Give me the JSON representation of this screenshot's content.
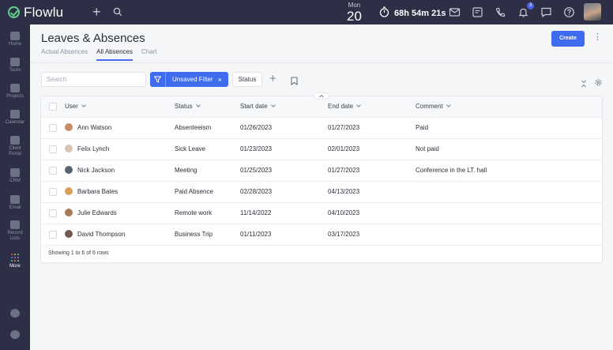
{
  "app": {
    "name": "Flowlu",
    "date": {
      "dow": "Mon",
      "day": "20"
    },
    "timer": "68h 54m 21s",
    "notification_count": "3"
  },
  "sidebar": {
    "items": [
      {
        "label": "Home",
        "icon": "home-icon"
      },
      {
        "label": "Tasks",
        "icon": "tasks-icon"
      },
      {
        "label": "Projects",
        "icon": "projects-icon"
      },
      {
        "label": "Calendar",
        "icon": "calendar-icon"
      },
      {
        "label": "Client\nPortal",
        "icon": "client-portal-icon"
      },
      {
        "label": "CRM",
        "icon": "crm-icon"
      },
      {
        "label": "Email",
        "icon": "email-icon"
      },
      {
        "label": "Record\nLists",
        "icon": "record-lists-icon"
      },
      {
        "label": "More",
        "icon": "more-grid-icon"
      }
    ]
  },
  "page": {
    "title": "Leaves & Absences",
    "tabs": [
      {
        "label": "Actual Absences"
      },
      {
        "label": "All Absences"
      },
      {
        "label": "Chart"
      }
    ],
    "create_label": "Create"
  },
  "toolbar": {
    "search_placeholder": "Search",
    "filter_label": "Unsaved Filter",
    "status_label": "Status"
  },
  "table": {
    "columns": [
      "User",
      "Status",
      "Start date",
      "End date",
      "Comment"
    ],
    "rows": [
      {
        "user": "Ann Watson",
        "status": "Absenteeism",
        "start": "01/26/2023",
        "end": "01/27/2023",
        "comment": "Paid"
      },
      {
        "user": "Felix Lynch",
        "status": "Sick Leave",
        "start": "01/23/2023",
        "end": "02/01/2023",
        "comment": "Not paid"
      },
      {
        "user": "Nick Jackson",
        "status": "Meeting",
        "start": "01/25/2023",
        "end": "01/27/2023",
        "comment": "Conference in the LT. hall"
      },
      {
        "user": "Barbara Bates",
        "status": "Paid Absence",
        "start": "02/28/2023",
        "end": "04/13/2023",
        "comment": ""
      },
      {
        "user": "Julie Edwards",
        "status": "Remote work",
        "start": "11/14/2022",
        "end": "04/10/2023",
        "comment": ""
      },
      {
        "user": "David Thompson",
        "status": "Business Trip",
        "start": "01/11/2023",
        "end": "03/17/2023",
        "comment": ""
      }
    ],
    "footer": "Showing 1 to 6 of 6 rows"
  },
  "colors": {
    "accent": "#3f6bee",
    "sidebar_bg": "#2c2f45",
    "logo_green": "#5fd38a"
  }
}
